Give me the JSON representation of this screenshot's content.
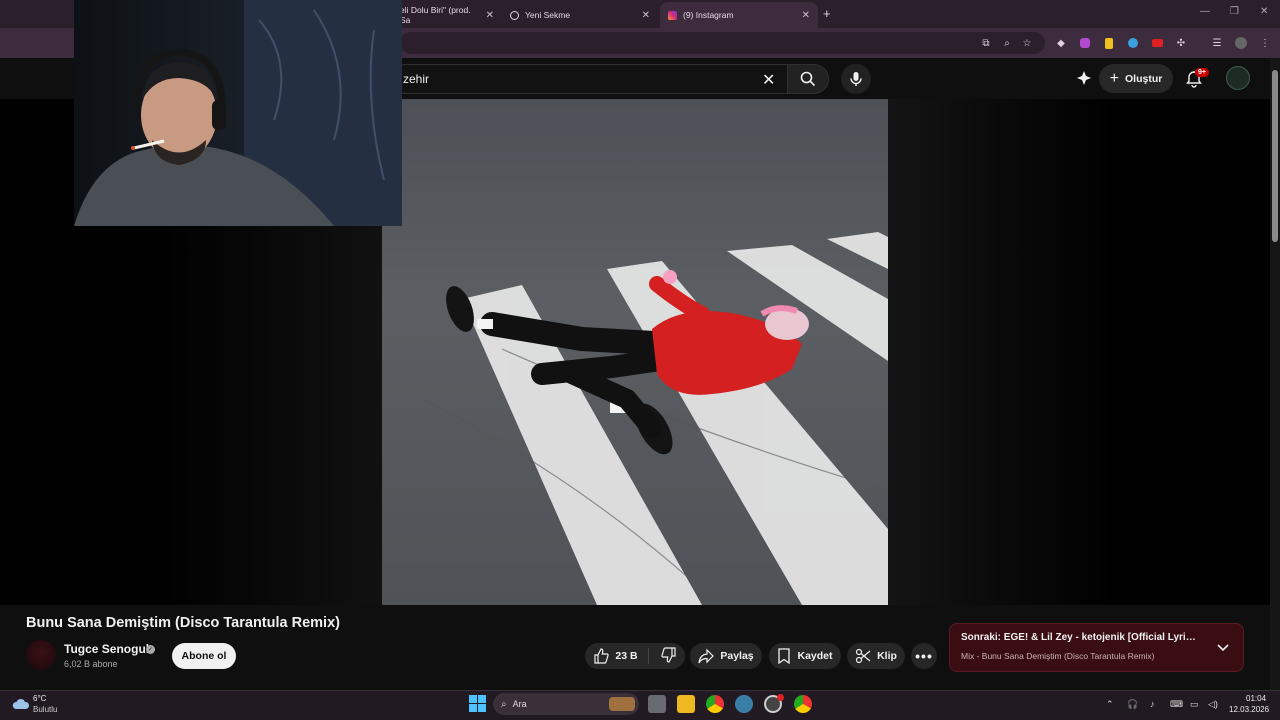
{
  "browser": {
    "tabs": [
      {
        "label": "eli Dolu Biri\" (prod. Sa",
        "active": false
      },
      {
        "label": "Yeni Sekme",
        "active": false
      },
      {
        "label": "(9) Instagram",
        "active": true
      }
    ],
    "new_tab": "+",
    "close": "✕"
  },
  "youtube": {
    "search_query": "zehir",
    "create_label": "Oluştur",
    "notifications_badge": "9+"
  },
  "video": {
    "title": "Bunu Sana Demiştim (Disco Tarantula Remix)",
    "channel": "Tugce Senogul",
    "subscribers": "6,02 B abone",
    "subscribe_label": "Abone ol",
    "likes": "23 B",
    "share_label": "Paylaş",
    "save_label": "Kaydet",
    "clip_label": "Klip"
  },
  "up_next": {
    "title": "Sonraki: EGE! & Lil Zey - ketojenik [Official Lyric Vid...",
    "subtitle": "Mix - Bunu Sana Demiştim (Disco Tarantula Remix)"
  },
  "taskbar": {
    "weather_temp": "6°C",
    "weather_condition": "Bulutlu",
    "search_label": "Ara",
    "time": "01:04",
    "date": "12.03.2026"
  },
  "colors": {
    "accent_red": "#cc0000",
    "up_next_bg": "#3a0d12",
    "hoodie_red": "#d42020"
  }
}
